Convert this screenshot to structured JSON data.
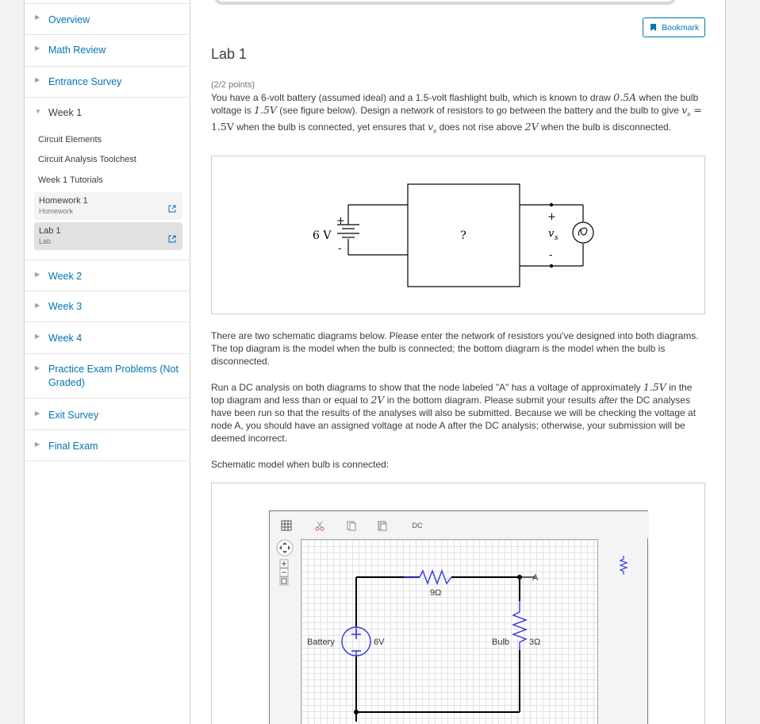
{
  "sidebar": {
    "chapters": [
      {
        "label": "Overview"
      },
      {
        "label": "Math Review"
      },
      {
        "label": "Entrance Survey"
      },
      {
        "label": "Week 1"
      },
      {
        "label": "Week 2"
      },
      {
        "label": "Week 3"
      },
      {
        "label": "Week 4"
      },
      {
        "label": "Practice Exam Problems (Not Graded)"
      },
      {
        "label": "Exit Survey"
      },
      {
        "label": "Final Exam"
      }
    ],
    "week1_items": [
      "Circuit Elements",
      "Circuit Analysis Toolchest",
      "Week 1 Tutorials"
    ],
    "homework": {
      "title": "Homework 1",
      "subtitle": "Homework"
    },
    "lab": {
      "title": "Lab 1",
      "subtitle": "Lab"
    }
  },
  "main": {
    "bookmark_label": "Bookmark",
    "title": "Lab 1",
    "points": "(2/2 points)",
    "intro": {
      "p1": "You have a 6-volt battery (assumed ideal) and a 1.5-volt flashlight bulb, which is known to draw ",
      "m1": "0.5A",
      "p2": " when the bulb voltage is ",
      "m2": "1.5V",
      "p3": " (see figure below). Design a network of resistors to go between the battery and the bulb to give ",
      "m3": "v",
      "m3sub": "s",
      "m3b": " = 1.5V",
      "p4": " when the bulb is connected, yet ensures that ",
      "m4": "v",
      "m4sub": "s",
      "p5": " does not rise above ",
      "m5": "2V",
      "p6": " when the bulb is disconnected."
    },
    "para2": "There are two schematic diagrams below. Please enter the network of resistors you've designed into both diagrams. The top diagram is the model when the bulb is connected; the bottom diagram is the model when the bulb is disconnected.",
    "para3": {
      "a": "Run a DC analysis on both diagrams to show that the node labeled \"A\" has a voltage of approximately ",
      "m1": "1.5V",
      "b": " in the top diagram and less than or equal to ",
      "m2": "2V",
      "c": " in the bottom diagram. Please submit your results ",
      "em": "after",
      "d": " the DC analyses have been run so that the results of the analyses will also be submitted. Because we will be checking the voltage at node A, you should have an assigned voltage at node A after the DC analysis; otherwise, your submission will be deemed incorrect."
    },
    "schematic_caption": "Schematic model when bulb is connected:",
    "figure": {
      "battery_label": "6 V",
      "box_label": "?",
      "plus": "+",
      "minus": "-",
      "vs": "v",
      "vs_sub": "s"
    },
    "schematic": {
      "dc_button": "DC",
      "resistor_label": "9Ω",
      "node_label": "A",
      "battery_label": "Battery",
      "battery_value": "6V",
      "bulb_label": "Bulb",
      "bulb_value": "3Ω"
    }
  },
  "colors": {
    "link": "#0075b4",
    "wire": "#000000",
    "component": "#3333dd"
  }
}
